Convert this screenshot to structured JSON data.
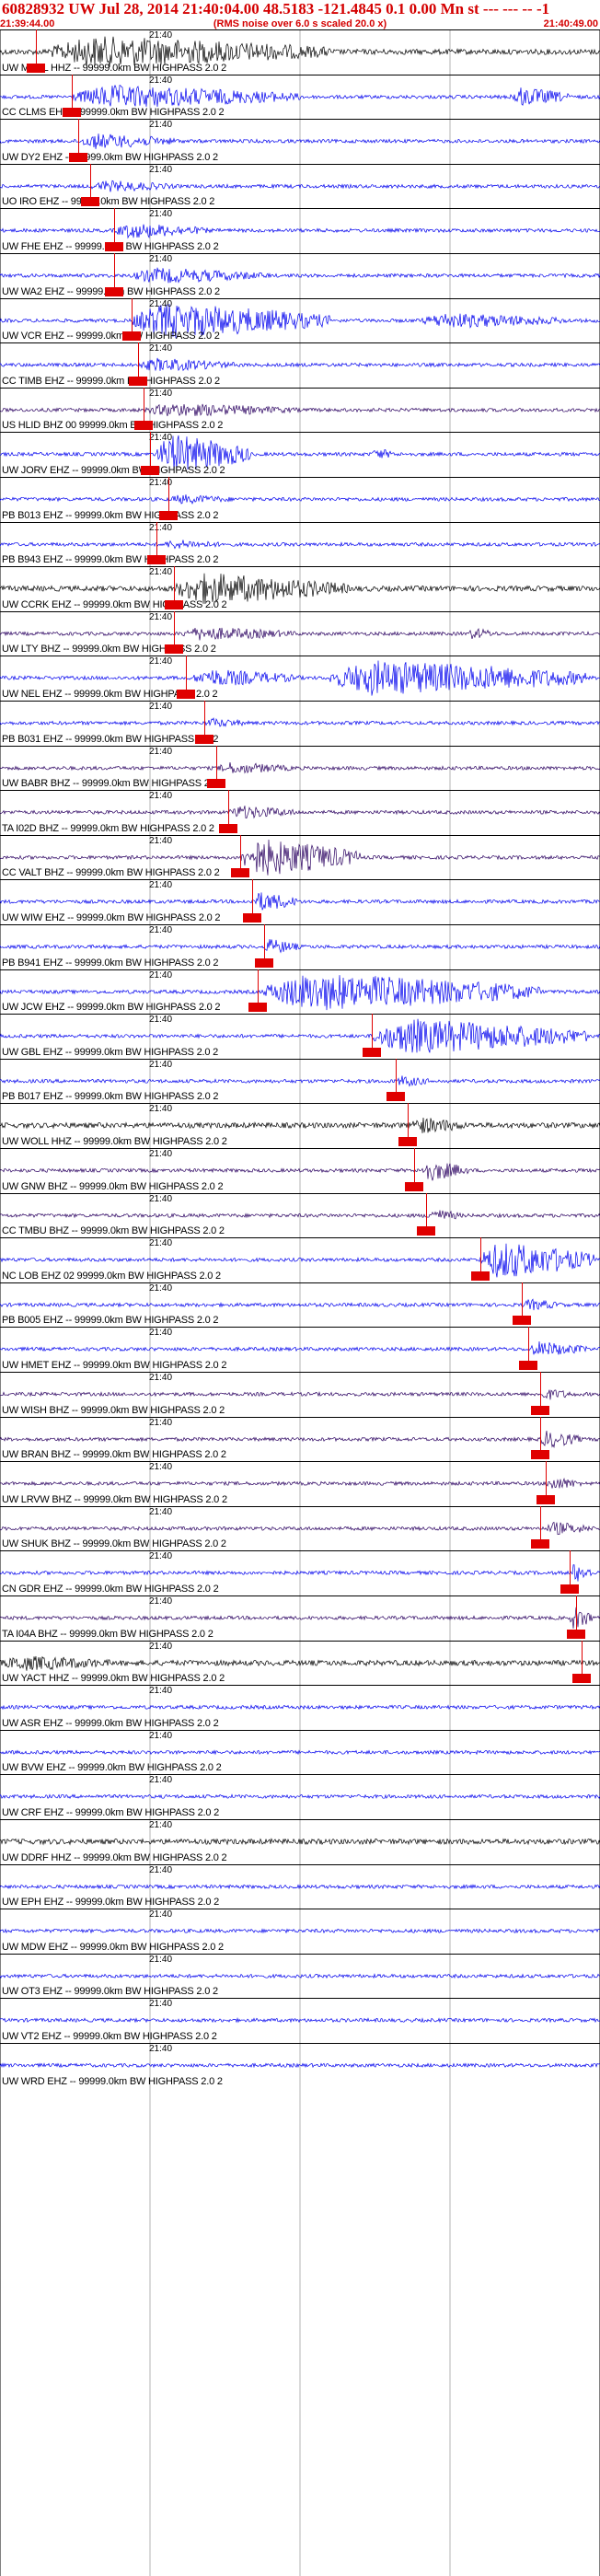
{
  "header": {
    "title": "60828932 UW Jul 28, 2014 21:40:04.00   48.5183 -121.4845   0.1 0.00 Mn st --- --- --   -1",
    "subtitle": "(RMS noise over 6.0 s scaled 20.0 x)",
    "start_time": "21:39:44.00",
    "end_time": "21:40:49.00"
  },
  "tick_label": "21:40",
  "colors": {
    "header": "#d40000",
    "pick": "#e00000",
    "black": "#000000",
    "blue": "#0000ee",
    "purple": "#2a0060"
  },
  "rows": [
    {
      "label": "UW MRBL HHZ -- 99999.0km BW  HIGHPASS  2.0  2",
      "color": "black",
      "pick": 0.06,
      "energy": [
        [
          0.08,
          0.55,
          0.8
        ]
      ]
    },
    {
      "label": "CC CLMS EHZ -- 99999.0km BW  HIGHPASS  2.0  2",
      "color": "blue",
      "pick": 0.12,
      "energy": [
        [
          0.12,
          0.5,
          0.6
        ],
        [
          0.85,
          0.95,
          0.5
        ]
      ]
    },
    {
      "label": "UW DY2 EHZ -- 99999.0km BW  HIGHPASS  2.0  2",
      "color": "blue",
      "pick": 0.13,
      "energy": [
        [
          0.13,
          0.3,
          0.4
        ]
      ]
    },
    {
      "label": "UO IRO EHZ -- 99999.0km BW  HIGHPASS  2.0  2",
      "color": "blue",
      "pick": 0.15,
      "energy": [
        [
          0.15,
          0.3,
          0.3
        ]
      ]
    },
    {
      "label": "UW FHE EHZ -- 99999.0km BW  HIGHPASS  2.0  2",
      "color": "blue",
      "pick": 0.19,
      "energy": [
        [
          0.19,
          0.35,
          0.4
        ]
      ]
    },
    {
      "label": "UW WA2 EHZ -- 99999.0km BW  HIGHPASS  2.0  2",
      "color": "blue",
      "pick": 0.19,
      "energy": [
        [
          0.22,
          0.45,
          0.4
        ]
      ]
    },
    {
      "label": "UW VCR EHZ -- 99999.0km BW  HIGHPASS  2.0  2",
      "color": "blue",
      "pick": 0.22,
      "energy": [
        [
          0.22,
          0.55,
          0.9
        ],
        [
          0.7,
          0.95,
          0.4
        ]
      ]
    },
    {
      "label": "CC TIMB EHZ -- 99999.0km BW  HIGHPASS  2.0  2",
      "color": "blue",
      "pick": 0.23,
      "energy": [
        [
          0.23,
          0.4,
          0.35
        ]
      ]
    },
    {
      "label": "US HLID BHZ 00 99999.0km BW  HIGHPASS  2.0  2",
      "color": "purple",
      "pick": 0.24,
      "energy": [
        [
          0.24,
          0.5,
          0.35
        ]
      ]
    },
    {
      "label": "UW JORV EHZ -- 99999.0km BW  HIGHPASS  2.0  2",
      "color": "blue",
      "pick": 0.25,
      "energy": [
        [
          0.26,
          0.42,
          1.0
        ],
        [
          0.62,
          0.66,
          0.3
        ]
      ]
    },
    {
      "label": "PB B013 EHZ -- 99999.0km BW  HIGHPASS  2.0  2",
      "color": "blue",
      "pick": 0.28,
      "energy": [
        [
          0.28,
          0.4,
          0.25
        ]
      ]
    },
    {
      "label": "PB B943 EHZ -- 99999.0km BW  HIGHPASS  2.0  2",
      "color": "blue",
      "pick": 0.26,
      "energy": [
        [
          0.27,
          0.38,
          0.25
        ]
      ]
    },
    {
      "label": "UW CCRK EHZ -- 99999.0km BW  HIGHPASS  2.0  2",
      "color": "black",
      "pick": 0.29,
      "energy": [
        [
          0.29,
          0.58,
          0.8
        ]
      ]
    },
    {
      "label": "UW LTY BHZ -- 99999.0km BW  HIGHPASS  2.0  2",
      "color": "purple",
      "pick": 0.29,
      "energy": [
        [
          0.3,
          0.5,
          0.35
        ],
        [
          0.78,
          0.83,
          0.3
        ]
      ]
    },
    {
      "label": "UW NEL EHZ -- 99999.0km BW  HIGHPASS  2.0  2",
      "color": "blue",
      "pick": 0.31,
      "energy": [
        [
          0.32,
          0.5,
          0.45
        ],
        [
          0.55,
          0.98,
          0.9
        ]
      ]
    },
    {
      "label": "PB B031 EHZ -- 99999.0km BW  HIGHPASS  2.0  2",
      "color": "blue",
      "pick": 0.34,
      "energy": [
        [
          0.34,
          0.42,
          0.25
        ]
      ]
    },
    {
      "label": "UW BABR BHZ -- 99999.0km BW  HIGHPASS  2.0  2",
      "color": "purple",
      "pick": 0.36,
      "energy": [
        [
          0.36,
          0.5,
          0.3
        ]
      ]
    },
    {
      "label": "TA I02D BHZ -- 99999.0km BW  HIGHPASS  2.0  2",
      "color": "purple",
      "pick": 0.38,
      "energy": [
        [
          0.38,
          0.5,
          0.35
        ]
      ]
    },
    {
      "label": "CC VALT BHZ -- 99999.0km BW  HIGHPASS  2.0  2",
      "color": "purple",
      "pick": 0.4,
      "energy": [
        [
          0.4,
          0.6,
          0.95
        ]
      ]
    },
    {
      "label": "UW WIW EHZ -- 99999.0km BW  HIGHPASS  2.0  2",
      "color": "blue",
      "pick": 0.42,
      "energy": [
        [
          0.42,
          0.5,
          0.5
        ]
      ]
    },
    {
      "label": "PB B941 EHZ -- 99999.0km BW  HIGHPASS  2.0  2",
      "color": "blue",
      "pick": 0.44,
      "energy": [
        [
          0.44,
          0.5,
          0.4
        ]
      ]
    },
    {
      "label": "UW JCW EHZ -- 99999.0km BW  HIGHPASS  2.0  2",
      "color": "blue",
      "pick": 0.43,
      "energy": [
        [
          0.44,
          0.9,
          0.95
        ]
      ]
    },
    {
      "label": "UW GBL EHZ -- 99999.0km BW  HIGHPASS  2.0  2",
      "color": "blue",
      "pick": 0.62,
      "energy": [
        [
          0.62,
          0.98,
          0.9
        ]
      ]
    },
    {
      "label": "PB B017 EHZ -- 99999.0km BW  HIGHPASS  2.0  2",
      "color": "blue",
      "pick": 0.66,
      "energy": [
        [
          0.66,
          0.72,
          0.3
        ]
      ]
    },
    {
      "label": "UW WOLL HHZ -- 99999.0km BW  HIGHPASS  2.0  2",
      "color": "black",
      "pick": 0.68,
      "energy": [
        [
          0.68,
          0.78,
          0.45
        ]
      ]
    },
    {
      "label": "UW GNW BHZ -- 99999.0km BW  HIGHPASS  2.0  2",
      "color": "purple",
      "pick": 0.69,
      "energy": [
        [
          0.7,
          0.78,
          0.55
        ]
      ]
    },
    {
      "label": "CC TMBU BHZ -- 99999.0km BW  HIGHPASS  2.0  2",
      "color": "purple",
      "pick": 0.71,
      "energy": [
        [
          0.71,
          0.77,
          0.35
        ]
      ]
    },
    {
      "label": "NC LOB EHZ 02 99999.0km BW  HIGHPASS  2.0  2",
      "color": "blue",
      "pick": 0.8,
      "energy": [
        [
          0.8,
          0.99,
          0.95
        ]
      ]
    },
    {
      "label": "PB B005 EHZ -- 99999.0km BW  HIGHPASS  2.0  2",
      "color": "blue",
      "pick": 0.87,
      "energy": [
        [
          0.87,
          0.94,
          0.3
        ]
      ]
    },
    {
      "label": "UW HMET EHZ -- 99999.0km BW  HIGHPASS  2.0  2",
      "color": "blue",
      "pick": 0.88,
      "energy": [
        [
          0.88,
          0.98,
          0.4
        ]
      ]
    },
    {
      "label": "UW WISH BHZ -- 99999.0km BW  HIGHPASS  2.0  2",
      "color": "purple",
      "pick": 0.9,
      "energy": [
        [
          0.9,
          0.96,
          0.3
        ]
      ]
    },
    {
      "label": "UW BRAN BHZ -- 99999.0km BW  HIGHPASS  2.0  2",
      "color": "purple",
      "pick": 0.9,
      "energy": [
        [
          0.9,
          0.97,
          0.45
        ]
      ]
    },
    {
      "label": "UW LRVW BHZ -- 99999.0km BW  HIGHPASS  2.0  2",
      "color": "purple",
      "pick": 0.91,
      "energy": [
        [
          0.91,
          0.97,
          0.35
        ]
      ]
    },
    {
      "label": "UW SHUK BHZ -- 99999.0km BW  HIGHPASS  2.0  2",
      "color": "purple",
      "pick": 0.9,
      "energy": [
        [
          0.91,
          0.99,
          0.35
        ]
      ]
    },
    {
      "label": "CN GDR EHZ -- 99999.0km BW  HIGHPASS  2.0  2",
      "color": "blue",
      "pick": 0.95,
      "energy": [
        [
          0.95,
          0.99,
          0.5
        ]
      ]
    },
    {
      "label": "TA I04A BHZ -- 99999.0km BW  HIGHPASS  2.0  2",
      "color": "purple",
      "pick": 0.96,
      "energy": [
        [
          0.95,
          0.99,
          0.6
        ]
      ]
    },
    {
      "label": "UW YACT HHZ -- 99999.0km BW  HIGHPASS  2.0  2",
      "color": "black",
      "pick": 0.97,
      "energy": [
        [
          0.0,
          0.2,
          0.4
        ]
      ]
    },
    {
      "label": "UW ASR EHZ -- 99999.0km BW  HIGHPASS  2.0  2",
      "color": "blue",
      "pick": -1,
      "energy": []
    },
    {
      "label": "UW BVW EHZ -- 99999.0km BW  HIGHPASS  2.0  2",
      "color": "blue",
      "pick": -1,
      "energy": []
    },
    {
      "label": "UW CRF EHZ -- 99999.0km BW  HIGHPASS  2.0  2",
      "color": "blue",
      "pick": -1,
      "energy": []
    },
    {
      "label": "UW DDRF HHZ -- 99999.0km BW  HIGHPASS  2.0  2",
      "color": "black",
      "pick": -1,
      "energy": []
    },
    {
      "label": "UW EPH EHZ -- 99999.0km BW  HIGHPASS  2.0  2",
      "color": "blue",
      "pick": -1,
      "energy": []
    },
    {
      "label": "UW MDW EHZ -- 99999.0km BW  HIGHPASS  2.0  2",
      "color": "blue",
      "pick": -1,
      "energy": []
    },
    {
      "label": "UW OT3 EHZ -- 99999.0km BW  HIGHPASS  2.0  2",
      "color": "blue",
      "pick": -1,
      "energy": []
    },
    {
      "label": "UW VT2 EHZ -- 99999.0km BW  HIGHPASS  2.0  2",
      "color": "blue",
      "pick": -1,
      "energy": []
    },
    {
      "label": "UW WRD EHZ -- 99999.0km BW  HIGHPASS  2.0  2",
      "color": "blue",
      "pick": -1,
      "energy": []
    }
  ]
}
